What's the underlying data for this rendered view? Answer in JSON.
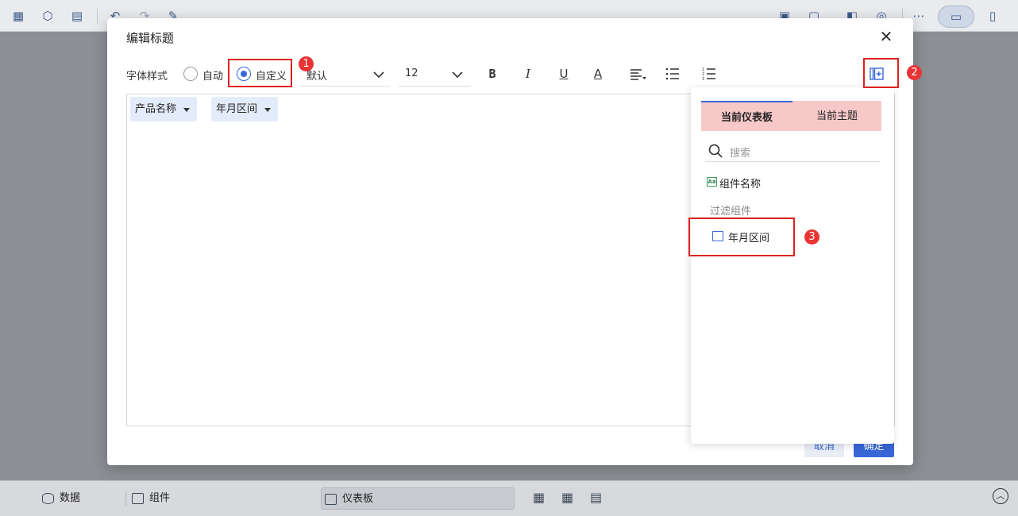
{
  "background": {
    "bottom_tabs": [
      {
        "label": "数据"
      },
      {
        "label": "组件"
      },
      {
        "label": "仪表板"
      }
    ]
  },
  "dialog": {
    "title": "编辑标题",
    "close_icon": "close-icon",
    "toolbar": {
      "font_style_label": "字体样式",
      "radio_auto": "自动",
      "radio_custom": "自定义",
      "selected_mode": "custom",
      "font_family": "默认",
      "font_size": "12",
      "bold": "B",
      "italic": "I",
      "underline": "U",
      "font_color": "A"
    },
    "editor": {
      "tags": [
        {
          "label": "产品名称"
        },
        {
          "label": "年月区间"
        }
      ]
    },
    "buttons": {
      "cancel": "取消",
      "ok": "确定"
    }
  },
  "panel": {
    "tabs": [
      {
        "label": "当前仪表板",
        "active": true
      },
      {
        "label": "当前主题",
        "active": false
      }
    ],
    "search_placeholder": "搜索",
    "component_name": "组件名称",
    "filter_group_label": "过滤组件",
    "filter_items": [
      {
        "label": "年月区间"
      }
    ]
  },
  "annotations": {
    "badge_1": "1",
    "badge_2": "2",
    "badge_3": "3",
    "highlight_color": "#e02020"
  },
  "colors": {
    "accent": "#3866d6",
    "tab_pink": "#f7c8c8",
    "tag_bg": "#e3ecfb"
  }
}
